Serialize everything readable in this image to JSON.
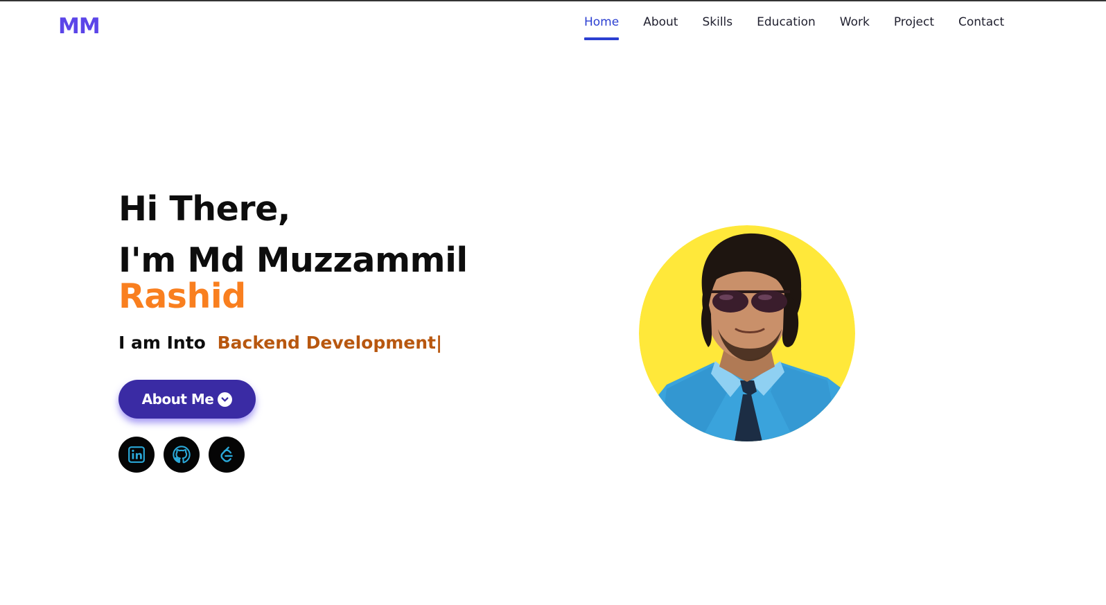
{
  "logo": "MM",
  "nav": {
    "items": [
      {
        "label": "Home"
      },
      {
        "label": "About"
      },
      {
        "label": "Skills"
      },
      {
        "label": "Education"
      },
      {
        "label": "Work"
      },
      {
        "label": "Project"
      },
      {
        "label": "Contact"
      }
    ],
    "active": "Home"
  },
  "hero": {
    "greeting": "Hi There,",
    "name": "I'm Md Muzzammil",
    "surname": "Rashid",
    "into_prefix": "I am Into",
    "role": "Backend Development",
    "cursor": "|",
    "button_label": "About Me"
  },
  "social_icons": [
    "linkedin-icon",
    "github-icon",
    "leetcode-icon"
  ],
  "colors": {
    "logo": "#5b45e8",
    "nav_active": "#2b3fd1",
    "surname": "#f97f1f",
    "role": "#b8570f",
    "button": "#3a2ba4",
    "social_icon": "#2aa8d8",
    "avatar_bg": "#ffe83a"
  }
}
